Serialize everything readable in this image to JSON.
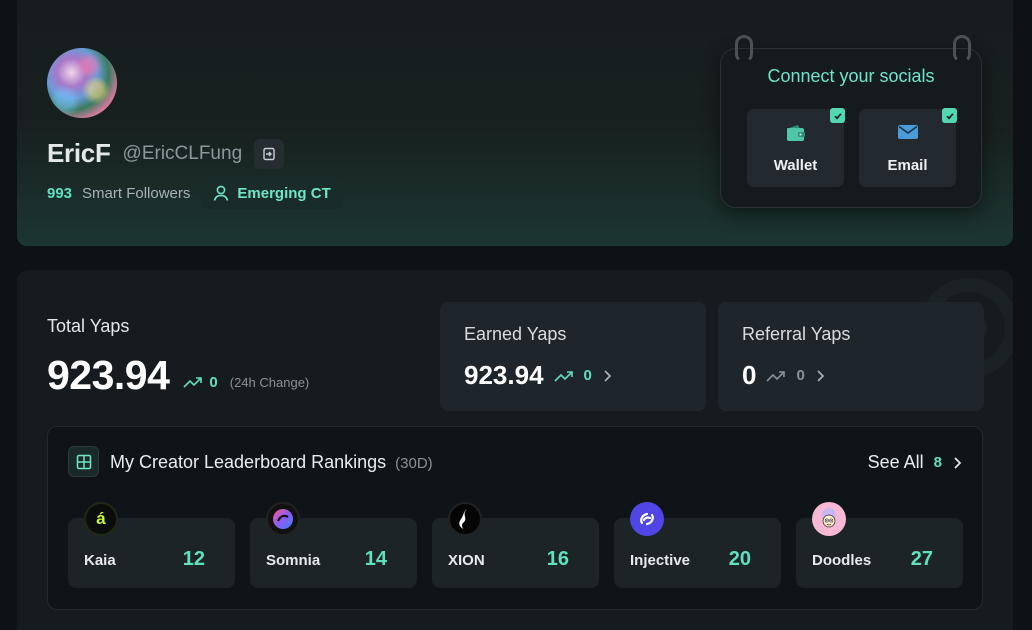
{
  "profile": {
    "display_name": "EricF",
    "handle": "@EricCLFung",
    "smart_followers_count": "993",
    "smart_followers_label": "Smart Followers",
    "badge_label": "Emerging CT"
  },
  "socials": {
    "title": "Connect your socials",
    "items": [
      {
        "label": "Wallet",
        "icon": "wallet-icon",
        "connected": true
      },
      {
        "label": "Email",
        "icon": "email-icon",
        "connected": true
      }
    ]
  },
  "yaps": {
    "total_label": "Total Yaps",
    "total_value": "923.94",
    "total_change": "0",
    "total_change_note": "(24h Change)",
    "earned_label": "Earned Yaps",
    "earned_value": "923.94",
    "earned_change": "0",
    "referral_label": "Referral Yaps",
    "referral_value": "0",
    "referral_change": "0"
  },
  "leaderboard": {
    "title": "My Creator Leaderboard Rankings",
    "period": "(30D)",
    "see_all_label": "See All",
    "see_all_count": "8",
    "items": [
      {
        "name": "Kaia",
        "rank": "12",
        "logo_text": "á"
      },
      {
        "name": "Somnia",
        "rank": "14",
        "logo_text": ""
      },
      {
        "name": "XION",
        "rank": "16",
        "logo_text": ""
      },
      {
        "name": "Injective",
        "rank": "20",
        "logo_text": ""
      },
      {
        "name": "Doodles",
        "rank": "27",
        "logo_text": ""
      }
    ]
  },
  "colors": {
    "accent": "#5fe0bf",
    "background": "#0e1216",
    "card": "#1d2428"
  }
}
